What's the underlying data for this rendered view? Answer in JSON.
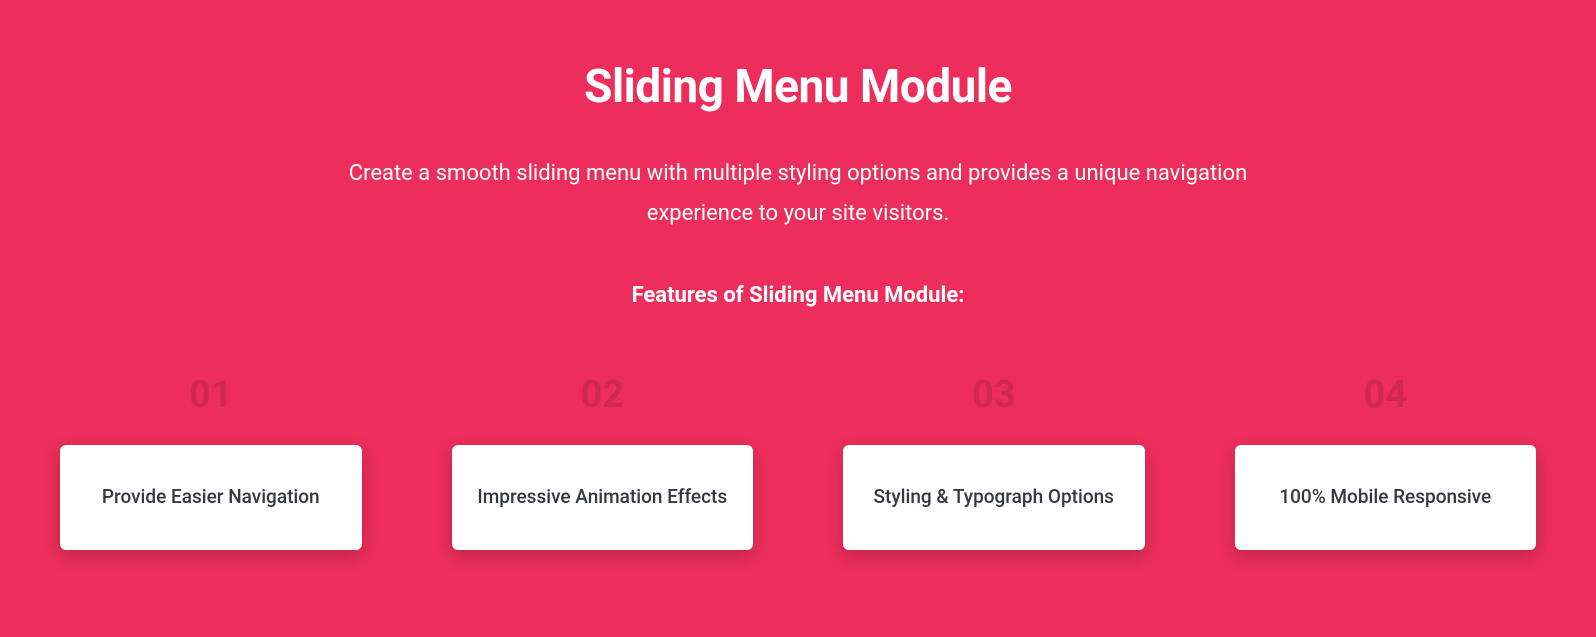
{
  "hero": {
    "title": "Sliding Menu Module",
    "description": "Create a smooth sliding menu with multiple styling options and provides a unique navigation experience to your site visitors.",
    "featuresHeading": "Features of Sliding Menu Module:"
  },
  "features": [
    {
      "number": "01",
      "label": "Provide Easier Navigation"
    },
    {
      "number": "02",
      "label": "Impressive Animation Effects"
    },
    {
      "number": "03",
      "label": "Styling & Typograph Options"
    },
    {
      "number": "04",
      "label": "100% Mobile Responsive"
    }
  ]
}
